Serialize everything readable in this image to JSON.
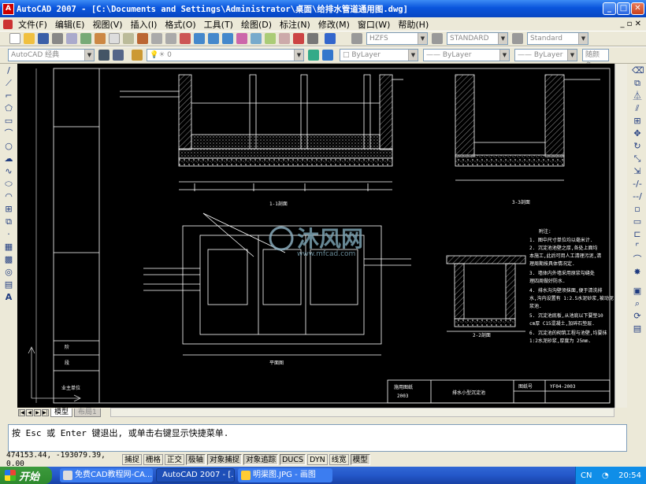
{
  "window": {
    "title": "AutoCAD 2007 - [C:\\Documents and Settings\\Administrator\\桌面\\给排水管道通用图.dwg]",
    "app_icon": "autocad-logo-icon"
  },
  "menu": [
    "文件(F)",
    "编辑(E)",
    "视图(V)",
    "插入(I)",
    "格式(O)",
    "工具(T)",
    "绘图(D)",
    "标注(N)",
    "修改(M)",
    "窗口(W)",
    "帮助(H)"
  ],
  "toolbar": {
    "text_style": "HZFS",
    "dim_style": "STANDARD",
    "table_style": "Standard",
    "workspace": "AutoCAD 经典",
    "layer": "0",
    "color": "ByLayer",
    "linetype": "ByLayer",
    "lineweight": "ByLayer",
    "plot_style": "随颜色"
  },
  "drawing": {
    "section11": "1-1剖面",
    "section33": "3-3剖面",
    "section22": "2-2剖面",
    "plan": "平面图",
    "watermark_cn": "沐风网",
    "watermark_url": "www.mfcad.com",
    "notes_title": "附注:",
    "notes": [
      "1. 图中尺寸单位均以毫米计.",
      "2. 沉淀池池壁之厚,各处上面均",
      "本施工,此后可用人工清理污泥,清",
      "理周期按具体情况定.",
      "3. 墙体内外墙采用原浆勾缝处",
      "理四周做好防水.",
      "4. 排水沟沟壁须抹面,便于清洗排",
      "水,沟内设置有 1:2.5水泥砂浆,被动泥",
      "浆池.",
      "5. 沉淀池底板,从池底以下要垫10",
      "cm厚 C15混凝土,加碎石垫层.",
      "6. 沉淀池的砌筑工程与池壁,均要抹",
      "1:2水泥砂浆,厚度为 25mm."
    ],
    "title_block": {
      "project": "施用图纸",
      "year": "2003",
      "name": "排水小型沉淀池",
      "drawing_no_label": "图纸号",
      "drawing_no": "YF04-2003",
      "left_labels": [
        "阶",
        "段"
      ],
      "owner_label": "业主单位"
    }
  },
  "tabs": {
    "model": "模型",
    "layout": "布局1"
  },
  "command": {
    "line1": "按 Esc 或 Enter 键退出, 或单击右键显示快捷菜单."
  },
  "status": {
    "coords": "474153.44, -193079.39, 0.00",
    "buttons": [
      {
        "label": "捕捉",
        "on": false
      },
      {
        "label": "栅格",
        "on": false
      },
      {
        "label": "正交",
        "on": false
      },
      {
        "label": "极轴",
        "on": true
      },
      {
        "label": "对象捕捉",
        "on": true
      },
      {
        "label": "对象追踪",
        "on": true
      },
      {
        "label": "DUCS",
        "on": true
      },
      {
        "label": "DYN",
        "on": false
      },
      {
        "label": "线宽",
        "on": false
      },
      {
        "label": "模型",
        "on": true
      }
    ]
  },
  "taskbar": {
    "start": "开始",
    "tasks": [
      "免费CAD教程网-CA...",
      "AutoCAD 2007 - [...",
      "明渠图.JPG - 画图"
    ],
    "lang": "CN",
    "time": "20:54"
  }
}
